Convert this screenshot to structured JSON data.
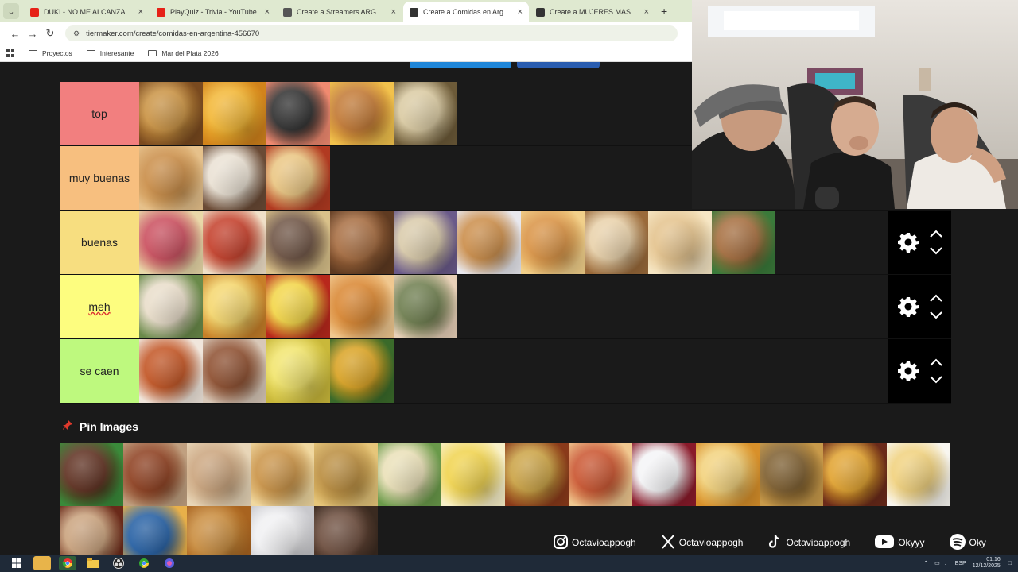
{
  "browser": {
    "tabs": [
      {
        "label": "DUKI - NO ME ALCANZA (V",
        "favicon_color": "#e62117",
        "active": false
      },
      {
        "label": "PlayQuiz - Trivia - YouTube",
        "favicon_color": "#e62117",
        "active": false
      },
      {
        "label": "Create a Streamers ARG (Twitch",
        "favicon_color": "#555555",
        "active": false
      },
      {
        "label": "Create a Comidas en Argentina",
        "favicon_color": "#333333",
        "active": true
      },
      {
        "label": "Create a MUJERES MAS HERMO",
        "favicon_color": "#333333",
        "active": false
      }
    ],
    "url": "tiermaker.com/create/comidas-en-argentina-456670",
    "bookmarks": [
      "Proyectos",
      "Interesante",
      "Mar del Plata 2026"
    ]
  },
  "tiers": [
    {
      "label": "top",
      "color": "#f27f7f",
      "items": [
        "empanadas",
        "french-fries",
        "sushi",
        "hamburger",
        "ice-cream"
      ]
    },
    {
      "label": "muy buenas",
      "color": "#f7bf7f",
      "items": [
        "medialunas",
        "chocotorta",
        "canelones"
      ]
    },
    {
      "label": "buenas",
      "color": "#f7de80",
      "items": [
        "picada",
        "ravioles",
        "pastel-de-papa",
        "buñuelos",
        "alfajores",
        "churros",
        "panqueques",
        "bolas-de-fraile",
        "chipa",
        "pollo"
      ]
    },
    {
      "label": "meh",
      "color": "#fdfd7f",
      "items": [
        "sandwich-de-miga",
        "bizcochuelo",
        "polenta",
        "rosquillas",
        "matambre"
      ]
    },
    {
      "label": "se caen",
      "color": "#bef97e",
      "items": [
        "guiso",
        "sopa",
        "humita",
        "locro"
      ]
    }
  ],
  "pin_images": {
    "title": "Pin Images",
    "items": [
      "brownie",
      "albondigas",
      "pan-casero",
      "flan",
      "milanesa",
      "ñoquis",
      "omelette",
      "milanesa-napolitana",
      "pancho",
      "postre",
      "pizza",
      "papas-al-horno",
      "tacos",
      "sopa-crema",
      "torta",
      "fideos",
      "waffles",
      "torta-blanca",
      "asado"
    ]
  },
  "socials": [
    {
      "icon": "instagram-icon",
      "handle": "Octavioappogh"
    },
    {
      "icon": "x-icon",
      "handle": "Octavioappogh"
    },
    {
      "icon": "tiktok-icon",
      "handle": "Octavioappogh"
    },
    {
      "icon": "youtube-icon",
      "handle": "Okyyy"
    },
    {
      "icon": "spotify-icon",
      "handle": "Oky"
    }
  ],
  "taskbar": {
    "lang": "ESP",
    "time": "01:16",
    "date": "12/12/2025"
  },
  "colors": {
    "page_bg": "#1a1a1a",
    "tab_bar_bg": "#dfe9d0",
    "taskbar_bg": "#1f2a38"
  }
}
